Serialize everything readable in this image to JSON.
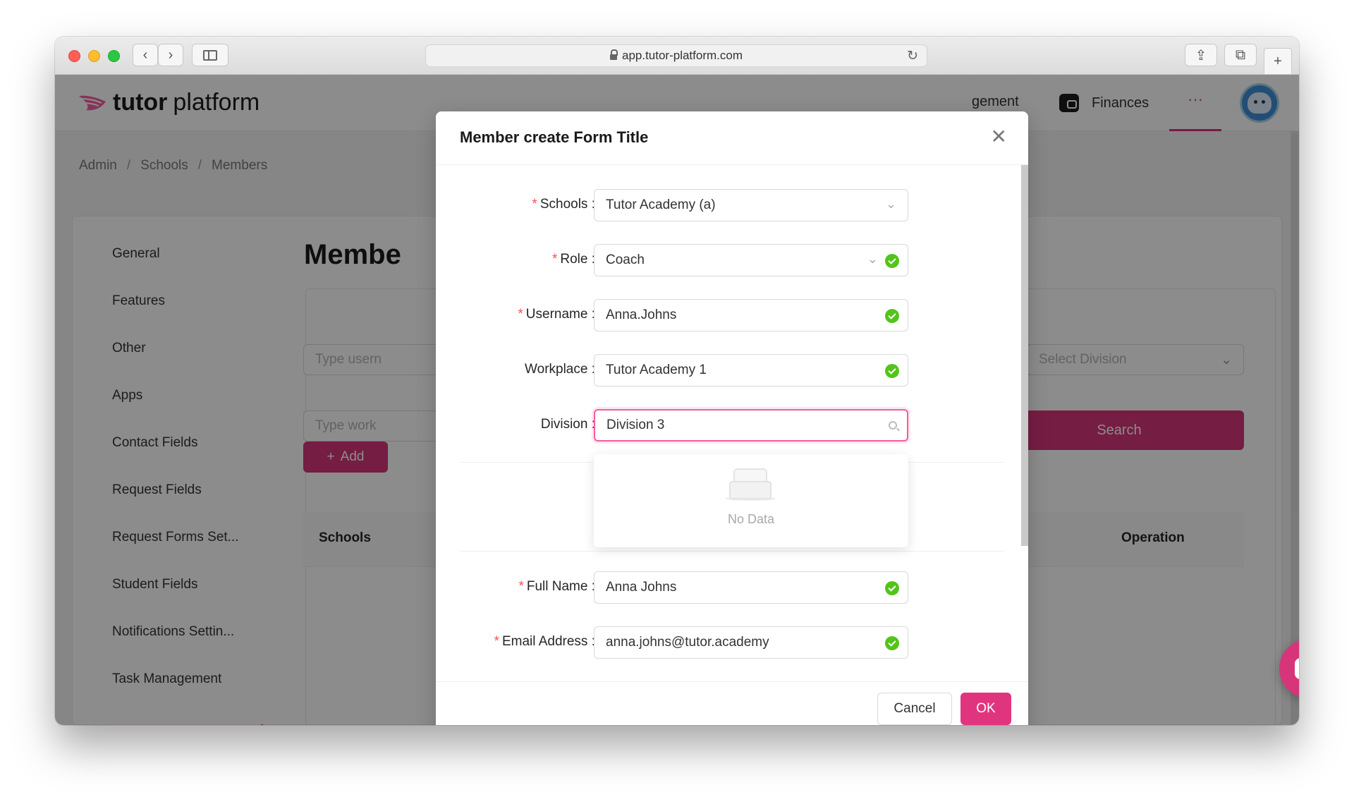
{
  "browser": {
    "url": "app.tutor-platform.com"
  },
  "header": {
    "logo_bold": "tutor",
    "logo_light": "platform",
    "nav_partial": "gement",
    "nav_finances": "Finances",
    "nav_more": "···"
  },
  "breadcrumb": [
    "Admin",
    "/",
    "Schools",
    "/",
    "Members"
  ],
  "sidebar": {
    "items": [
      {
        "label": "General"
      },
      {
        "label": "Features"
      },
      {
        "label": "Other"
      },
      {
        "label": "Apps"
      },
      {
        "label": "Contact Fields"
      },
      {
        "label": "Request Fields"
      },
      {
        "label": "Request Forms Set..."
      },
      {
        "label": "Student Fields"
      },
      {
        "label": "Notifications Settin..."
      },
      {
        "label": "Task Management"
      }
    ]
  },
  "main": {
    "title": "Membe",
    "filter_username_placeholder": "Type usern",
    "filter_workplace_placeholder": "Type work",
    "select_division_placeholder": "Select Division",
    "search_button": "Search",
    "add_button": "Add",
    "table_headers": {
      "schools": "Schools",
      "operation": "Operation"
    }
  },
  "modal": {
    "title": "Member create Form Title",
    "fields": {
      "schools": {
        "label": "Schools",
        "value": "Tutor Academy (a)"
      },
      "role": {
        "label": "Role",
        "value": "Coach"
      },
      "username": {
        "label": "Username",
        "value": "Anna.Johns"
      },
      "workplace": {
        "label": "Workplace",
        "value": "Tutor Academy 1"
      },
      "division": {
        "label": "Division",
        "value": "Division 3"
      },
      "full_name": {
        "label": "Full Name",
        "value": "Anna Johns"
      },
      "email": {
        "label": "Email Address",
        "value": "anna.johns@tutor.academy"
      }
    },
    "dropdown_empty": "No Data",
    "cancel": "Cancel",
    "ok": "OK"
  },
  "colors": {
    "accent": "#d6357a",
    "success": "#52c41a",
    "required": "#ff4d4f"
  }
}
